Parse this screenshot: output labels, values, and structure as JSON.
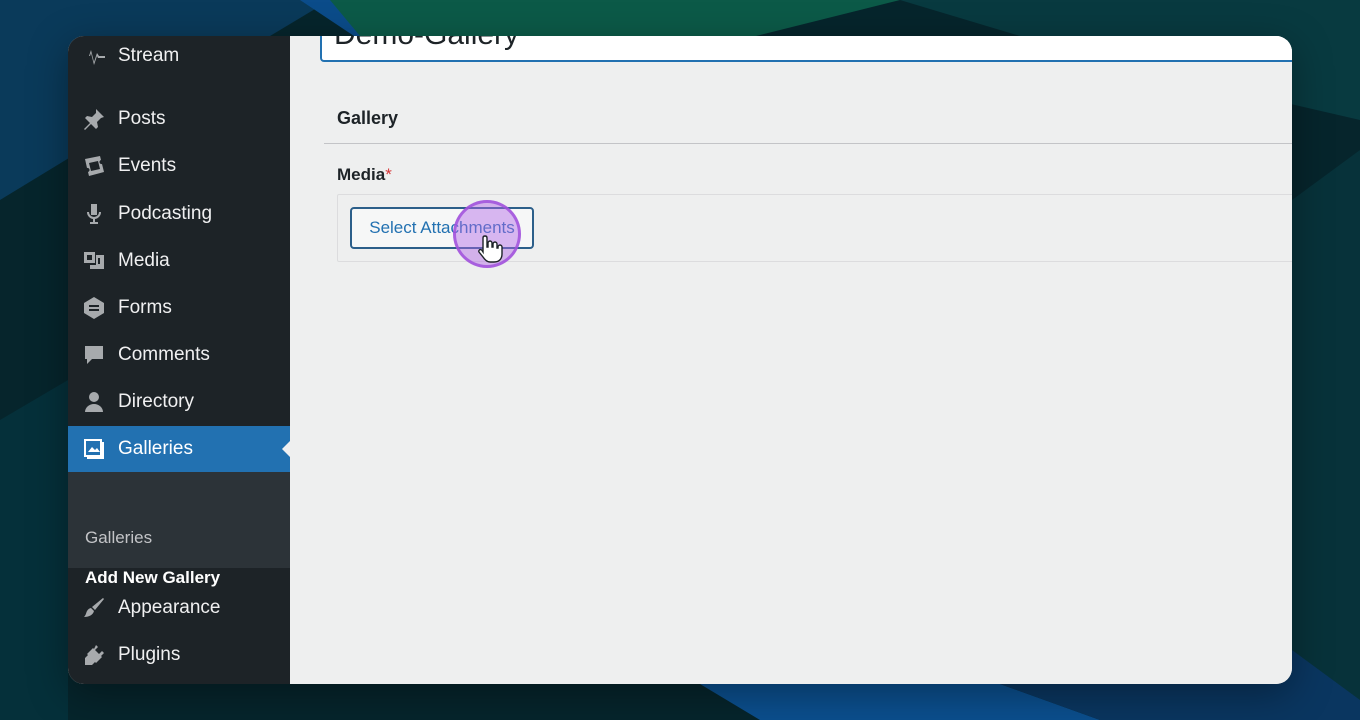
{
  "sidebar": {
    "items": [
      {
        "label": "Stream",
        "icon": "stream-icon"
      },
      {
        "label": "Posts",
        "icon": "pin-icon"
      },
      {
        "label": "Events",
        "icon": "ticket-icon"
      },
      {
        "label": "Podcasting",
        "icon": "microphone-icon"
      },
      {
        "label": "Media",
        "icon": "media-icon"
      },
      {
        "label": "Forms",
        "icon": "forms-icon"
      },
      {
        "label": "Comments",
        "icon": "comment-icon"
      },
      {
        "label": "Directory",
        "icon": "user-icon"
      },
      {
        "label": "Galleries",
        "icon": "gallery-icon",
        "active": true
      },
      {
        "label": "Appearance",
        "icon": "paintbrush-icon"
      },
      {
        "label": "Plugins",
        "icon": "plugin-icon"
      }
    ],
    "submenu": [
      {
        "label": "Galleries"
      },
      {
        "label": "Add New Gallery",
        "current": true
      }
    ]
  },
  "main": {
    "title_value": "Demo-Gallery",
    "section_title": "Gallery",
    "field_label": "Media",
    "required_mark": "*",
    "select_button_label": "Select Attachments"
  },
  "colors": {
    "sidebar_bg": "#1d2327",
    "submenu_bg": "#2c3338",
    "active_accent": "#2271b1",
    "content_bg": "#eeefef",
    "cursor_highlight": "#b266e6"
  }
}
